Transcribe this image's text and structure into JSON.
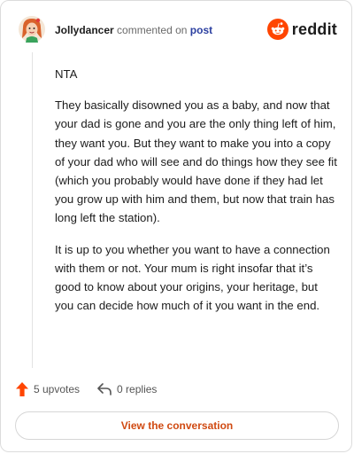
{
  "header": {
    "username": "Jollydancer",
    "action_text": "commented on",
    "post_link": "post",
    "logo_text": "reddit",
    "brand_color": "#ff4500",
    "avatar_icon": "avatar-icon"
  },
  "comment": {
    "paragraphs": [
      "NTA",
      "They basically disowned you as a baby, and now that your dad is gone and you are the only thing left of him, they want you. But they want to make you into a copy of your dad who will see and do things how they see fit (which you probably would have done if they had let you grow up with him and them, but now that train has long left the station).",
      "It is up to you whether you want to have a connection with them or not. Your mum is right insofar that it’s good to know about your origins, your heritage, but you can decide how much of it you want in the end."
    ]
  },
  "footer": {
    "upvotes_label": "5 upvotes",
    "replies_label": "0 replies",
    "upvote_color": "#ff4500"
  },
  "cta": {
    "label": "View the conversation",
    "color": "#d04a12"
  }
}
